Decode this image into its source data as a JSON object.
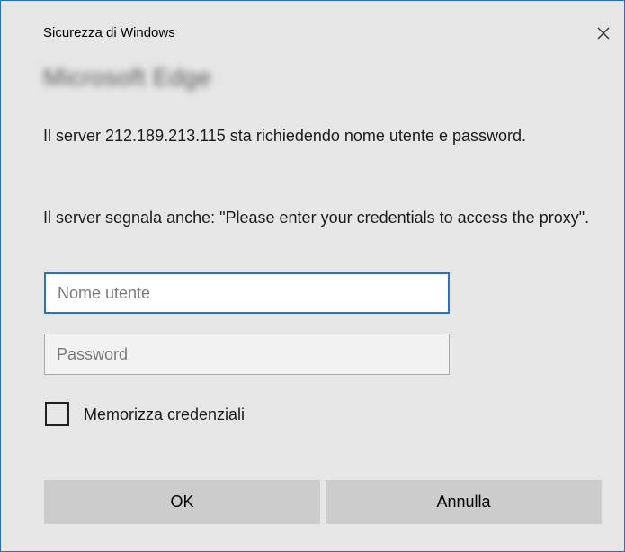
{
  "dialog": {
    "title": "Sicurezza di Windows",
    "app_name": "Microsoft Edge",
    "message_server": "Il server 212.189.213.115 sta richiedendo nome utente e password.",
    "message_extra": "Il server segnala anche: \"Please enter your credentials to access the proxy\"."
  },
  "form": {
    "username_placeholder": "Nome utente",
    "username_value": "",
    "password_placeholder": "Password",
    "password_value": "",
    "remember_label": "Memorizza credenziali",
    "remember_checked": false
  },
  "buttons": {
    "ok_label": "OK",
    "cancel_label": "Annulla"
  },
  "icons": {
    "close": "close-icon"
  },
  "colors": {
    "accent": "#2b73b8",
    "background": "#e6e6e6",
    "button": "#cccccc"
  }
}
